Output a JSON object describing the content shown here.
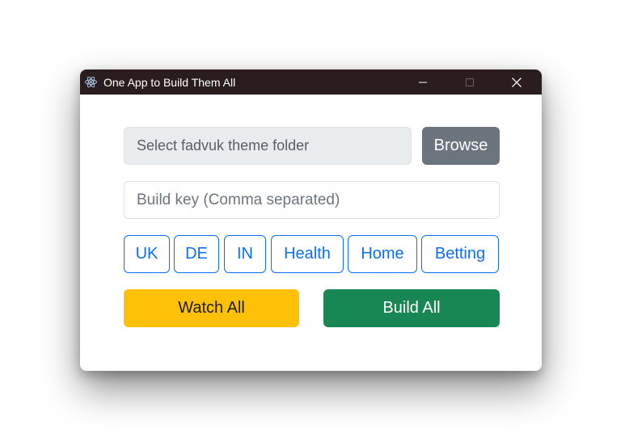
{
  "window": {
    "title": "One App to Build Them All",
    "icon": "electron-atom-icon",
    "controls": [
      "minimize-icon",
      "maximize-icon",
      "close-icon"
    ]
  },
  "folder": {
    "placeholder": "Select fadvuk theme folder",
    "browse_label": "Browse"
  },
  "build_key": {
    "placeholder": "Build key (Comma separated)",
    "value": ""
  },
  "tags": [
    {
      "label": "UK"
    },
    {
      "label": "DE"
    },
    {
      "label": "IN"
    },
    {
      "label": "Health"
    },
    {
      "label": "Home"
    },
    {
      "label": "Betting"
    }
  ],
  "actions": {
    "watch_label": "Watch All",
    "build_label": "Build All"
  },
  "colors": {
    "titlebar": "#2b1d1d",
    "secondary": "#6c757d",
    "primary": "#0d6efd",
    "warning": "#ffc107",
    "success": "#198754",
    "input_disabled_bg": "#e9ecef"
  }
}
